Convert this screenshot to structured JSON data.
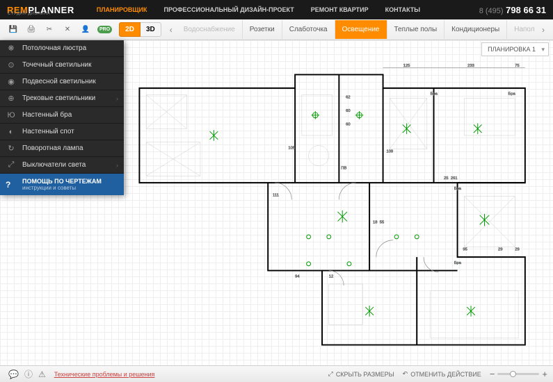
{
  "header": {
    "logo_rem": "REM",
    "logo_planner": "PLANNER",
    "logo_sub": "СТУДИЯ ДИЗАЙНА",
    "nav": [
      "ПЛАНИРОВЩИК",
      "ПРОФЕССИОНАЛЬНЫЙ ДИЗАЙН-ПРОЕКТ",
      "РЕМОНТ КВАРТИР",
      "КОНТАКТЫ"
    ],
    "phone_prefix": "8 (495)",
    "phone_main": " 798 66 31"
  },
  "toolbar": {
    "pro": "PRO",
    "view2d": "2D",
    "view3d": "3D",
    "tabs": [
      "Водоснабжение",
      "Розетки",
      "Слаботочка",
      "Освещение",
      "Теплые полы",
      "Кондиционеры",
      "Напол"
    ]
  },
  "sidebar": {
    "items": [
      "Потолочная люстра",
      "Точечный светильник",
      "Подвесной светильник",
      "Трековые светильники",
      "Настенный бра",
      "Настенный спот",
      "Поворотная лампа",
      "Выключатели света"
    ],
    "help_title": "ПОМОЩЬ ПО ЧЕРТЕЖАМ",
    "help_sub": "инструкции и советы"
  },
  "layout_dropdown": "ПЛАНИРОВКА 1",
  "floorplan": {
    "dims": [
      "125",
      "233",
      "75",
      "105",
      "111",
      "109",
      "261",
      "18",
      "55",
      "95",
      "29",
      "94",
      "12",
      "25",
      "29"
    ],
    "labels": [
      "Бра",
      "Бра",
      "Бра",
      "Бра",
      "ПВ",
      "60",
      "60",
      "62"
    ]
  },
  "statusbar": {
    "tech_link": "Технические проблемы и решения",
    "hide_dims": "СКРЫТЬ РАЗМЕРЫ",
    "undo": "ОТМЕНИТЬ ДЕЙСТВИЕ",
    "zoom_minus": "−",
    "zoom_plus": "+"
  }
}
